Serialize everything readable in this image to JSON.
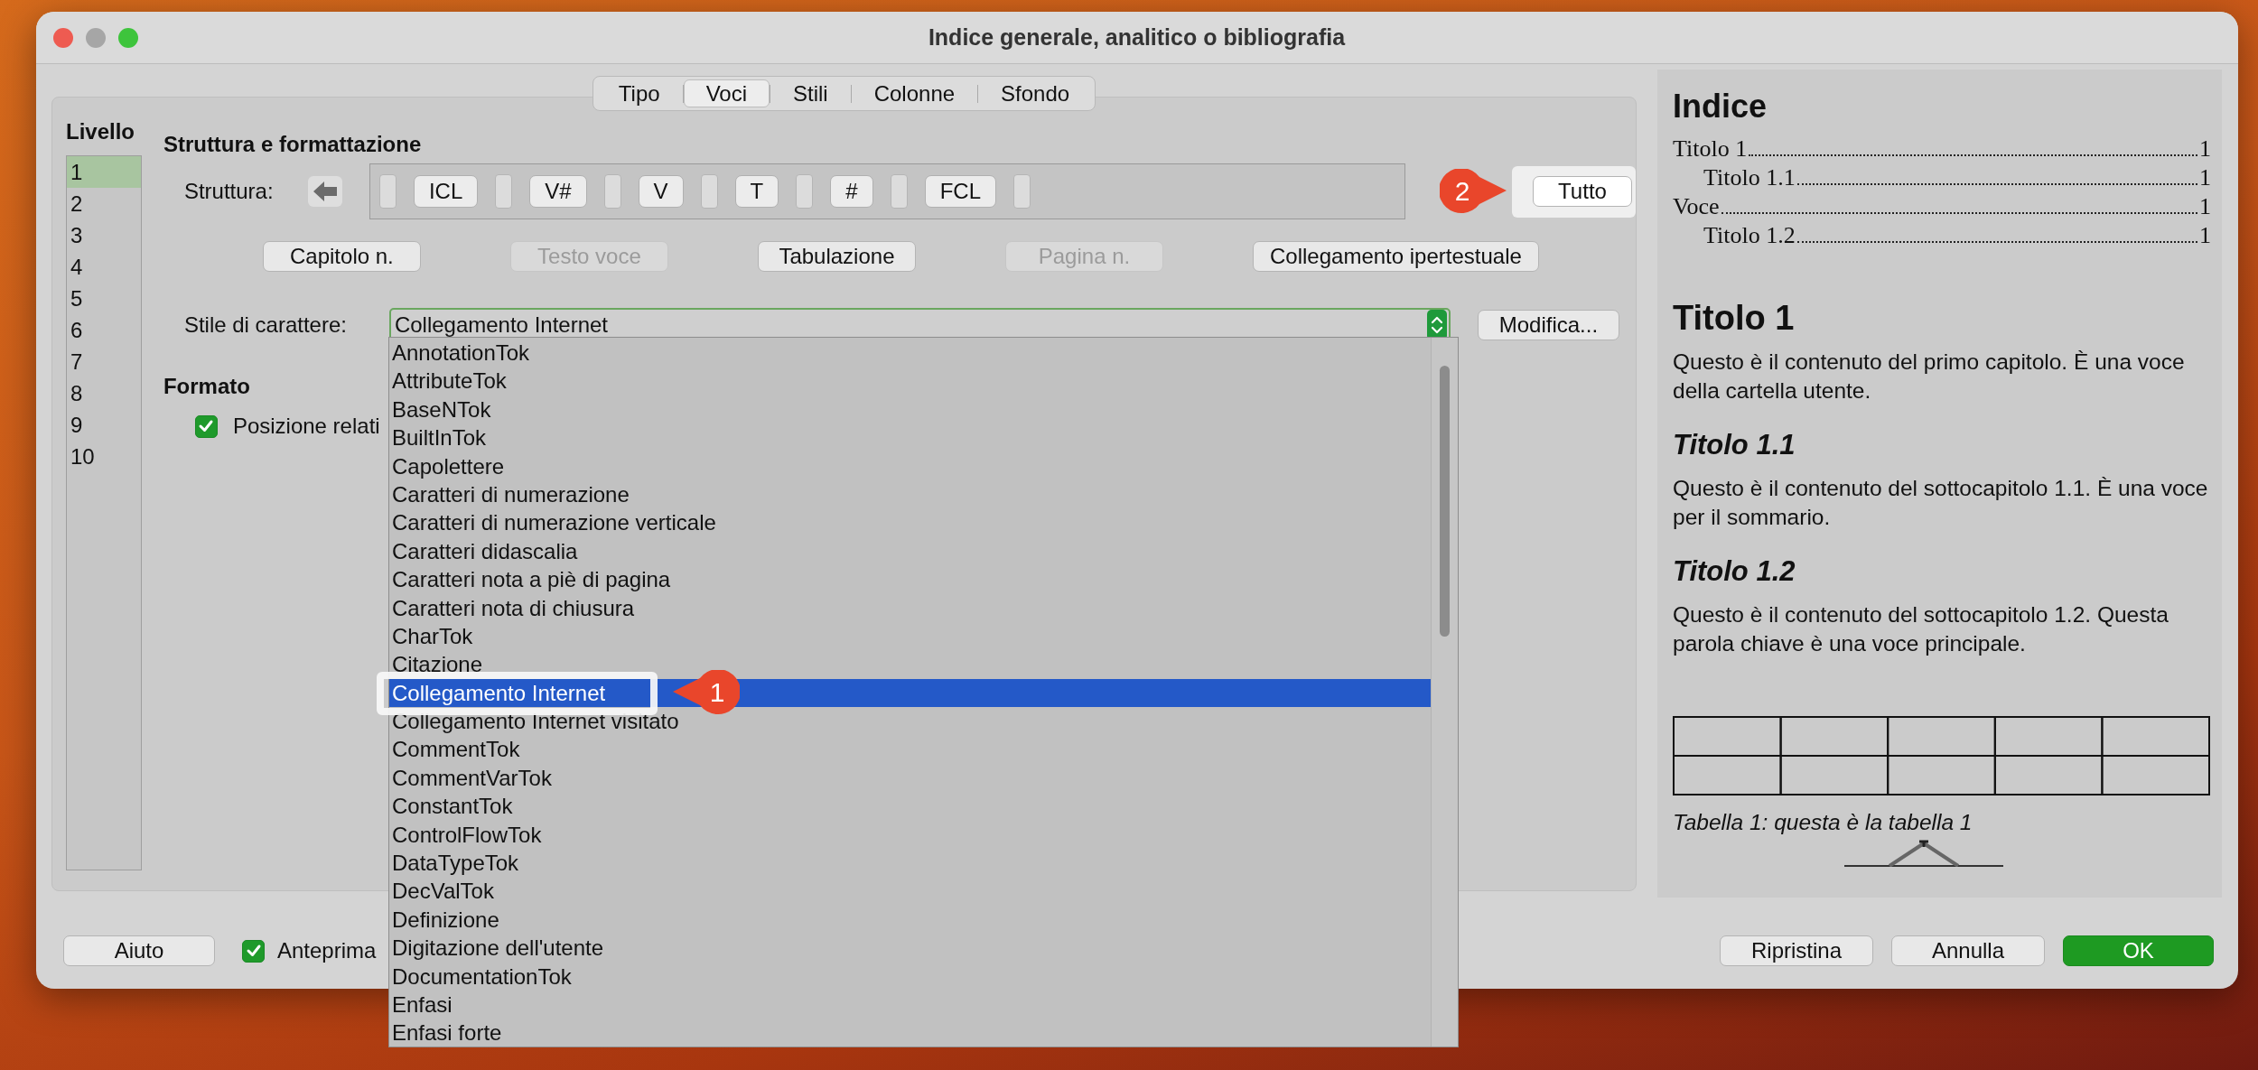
{
  "window": {
    "title": "Indice generale, analitico o bibliografia"
  },
  "tabs": [
    {
      "label": "Tipo",
      "selected": false
    },
    {
      "label": "Voci",
      "selected": true
    },
    {
      "label": "Stili",
      "selected": false
    },
    {
      "label": "Colonne",
      "selected": false
    },
    {
      "label": "Sfondo",
      "selected": false
    }
  ],
  "levels": {
    "title": "Livello",
    "items": [
      {
        "label": "1",
        "selected": true
      },
      {
        "label": "2",
        "selected": false
      },
      {
        "label": "3",
        "selected": false
      },
      {
        "label": "4",
        "selected": false
      },
      {
        "label": "5",
        "selected": false
      },
      {
        "label": "6",
        "selected": false
      },
      {
        "label": "7",
        "selected": false
      },
      {
        "label": "8",
        "selected": false
      },
      {
        "label": "9",
        "selected": false
      },
      {
        "label": "10",
        "selected": false
      }
    ]
  },
  "structure": {
    "heading": "Struttura e formattazione",
    "label": "Struttura:",
    "tokens": [
      {
        "kind": "slot"
      },
      {
        "kind": "token",
        "text": "ICL"
      },
      {
        "kind": "slot"
      },
      {
        "kind": "token",
        "text": "V#"
      },
      {
        "kind": "slot"
      },
      {
        "kind": "token",
        "text": "V"
      },
      {
        "kind": "slot"
      },
      {
        "kind": "token",
        "text": "T"
      },
      {
        "kind": "slot"
      },
      {
        "kind": "token",
        "text": "#"
      },
      {
        "kind": "slot"
      },
      {
        "kind": "token",
        "text": "FCL"
      },
      {
        "kind": "slot"
      }
    ],
    "all_button": "Tutto"
  },
  "insert_buttons": [
    {
      "label": "Capitolo n.",
      "disabled": false
    },
    {
      "label": "Testo voce",
      "disabled": true
    },
    {
      "label": "Tabulazione",
      "disabled": false
    },
    {
      "label": "Pagina n.",
      "disabled": true
    },
    {
      "label": "Collegamento ipertestuale",
      "disabled": false
    }
  ],
  "char_style": {
    "label": "Stile di carattere:",
    "value": "Collegamento Internet",
    "edit_button": "Modifica..."
  },
  "format": {
    "heading": "Formato",
    "option": {
      "label": "Posizione relati",
      "checked": true
    }
  },
  "dropdown": {
    "items": [
      {
        "label": "AnnotationTok",
        "selected": false
      },
      {
        "label": "AttributeTok",
        "selected": false
      },
      {
        "label": "BaseNTok",
        "selected": false
      },
      {
        "label": "BuiltInTok",
        "selected": false
      },
      {
        "label": "Capolettere",
        "selected": false
      },
      {
        "label": "Caratteri di numerazione",
        "selected": false
      },
      {
        "label": "Caratteri di numerazione verticale",
        "selected": false
      },
      {
        "label": "Caratteri didascalia",
        "selected": false
      },
      {
        "label": "Caratteri nota a piè di pagina",
        "selected": false
      },
      {
        "label": "Caratteri nota di chiusura",
        "selected": false
      },
      {
        "label": "CharTok",
        "selected": false
      },
      {
        "label": "Citazione",
        "selected": false
      },
      {
        "label": "Collegamento Internet",
        "selected": true
      },
      {
        "label": "Collegamento Internet visitato",
        "selected": false
      },
      {
        "label": "CommentTok",
        "selected": false
      },
      {
        "label": "CommentVarTok",
        "selected": false
      },
      {
        "label": "ConstantTok",
        "selected": false
      },
      {
        "label": "ControlFlowTok",
        "selected": false
      },
      {
        "label": "DataTypeTok",
        "selected": false
      },
      {
        "label": "DecValTok",
        "selected": false
      },
      {
        "label": "Definizione",
        "selected": false
      },
      {
        "label": "Digitazione dell'utente",
        "selected": false
      },
      {
        "label": "DocumentationTok",
        "selected": false
      },
      {
        "label": "Enfasi",
        "selected": false
      },
      {
        "label": "Enfasi forte",
        "selected": false
      }
    ]
  },
  "callouts": [
    {
      "number": "1",
      "kind": "left"
    },
    {
      "number": "2",
      "kind": "right"
    }
  ],
  "preview": {
    "title": "Indice",
    "toc": [
      {
        "text": "Titolo 1",
        "page": "1",
        "children": [
          {
            "text": "Titolo 1.1",
            "page": "1"
          }
        ]
      },
      {
        "text": "Voce",
        "page": "1",
        "children": [
          {
            "text": "Titolo 1.2",
            "page": "1"
          }
        ]
      }
    ],
    "sections": [
      {
        "kind": "chapter",
        "heading": "Titolo 1",
        "text": "Questo è il contenuto del primo capitolo. È una voce della cartella utente."
      },
      {
        "kind": "subchapter",
        "heading": "Titolo 1.1",
        "text": "Questo è il contenuto del sottocapitolo 1.1. È una voce per il sommario."
      },
      {
        "kind": "subchapter",
        "heading": "Titolo 1.2",
        "text": "Questo è il contenuto del sottocapitolo 1.2. Questa parola chiave è una voce principale."
      }
    ],
    "caption": "Tabella 1: questa è la tabella 1"
  },
  "bottom": {
    "help": "Aiuto",
    "preview_option": {
      "label": "Anteprima",
      "checked": true
    },
    "buttons": [
      {
        "label": "Ripristina",
        "kind": "normal"
      },
      {
        "label": "Annulla",
        "kind": "normal"
      },
      {
        "label": "OK",
        "kind": "default"
      }
    ]
  }
}
